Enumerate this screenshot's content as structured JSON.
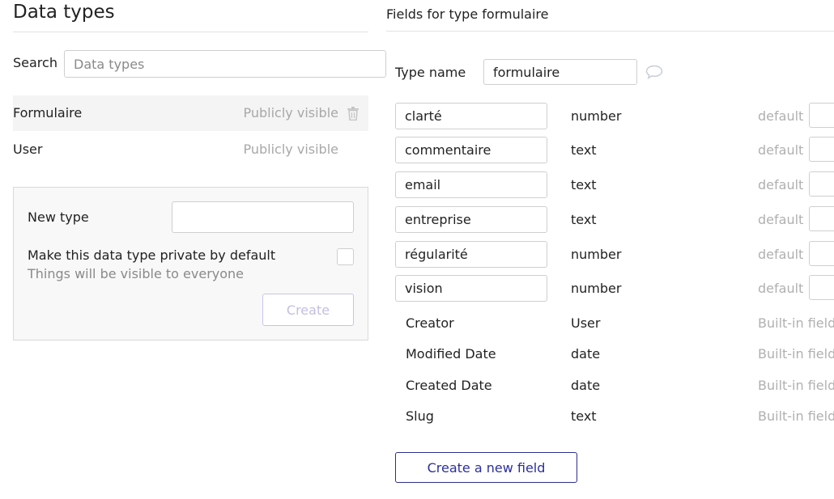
{
  "left_panel": {
    "title": "Data types",
    "search": {
      "label": "Search",
      "placeholder": "Data types",
      "value": ""
    },
    "types": [
      {
        "name": "Formulaire",
        "visibility": "Publicly visible",
        "selected": true,
        "delete_icon": "trash-icon"
      },
      {
        "name": "User",
        "visibility": "Publicly visible",
        "selected": false
      }
    ],
    "new_type": {
      "label": "New type",
      "value": "",
      "private_label": "Make this data type private by default",
      "private_hint": "Things will be visible to everyone",
      "private_checked": false,
      "create_label": "Create"
    }
  },
  "right_panel": {
    "title": "Fields for type formulaire",
    "type_name_label": "Type name",
    "type_name_value": "formulaire",
    "comment_icon": "speech-bubble-icon",
    "fields": [
      {
        "name": "clarté",
        "type": "number",
        "default_label": "default"
      },
      {
        "name": "commentaire",
        "type": "text",
        "default_label": "default"
      },
      {
        "name": "email",
        "type": "text",
        "default_label": "default"
      },
      {
        "name": "entreprise",
        "type": "text",
        "default_label": "default"
      },
      {
        "name": "régularité",
        "type": "number",
        "default_label": "default"
      },
      {
        "name": "vision",
        "type": "number",
        "default_label": "default"
      }
    ],
    "builtin_fields": [
      {
        "name": "Creator",
        "type": "User",
        "note": "Built-in field"
      },
      {
        "name": "Modified Date",
        "type": "date",
        "note": "Built-in field"
      },
      {
        "name": "Created Date",
        "type": "date",
        "note": "Built-in field"
      },
      {
        "name": "Slug",
        "type": "text",
        "note": "Built-in field"
      }
    ],
    "new_field_label": "Create a new field"
  },
  "colors": {
    "accent": "#2b2f9e",
    "muted_text": "#a8a8a8",
    "border": "#cfcfcf",
    "selected_row": "#f4f4f4"
  }
}
